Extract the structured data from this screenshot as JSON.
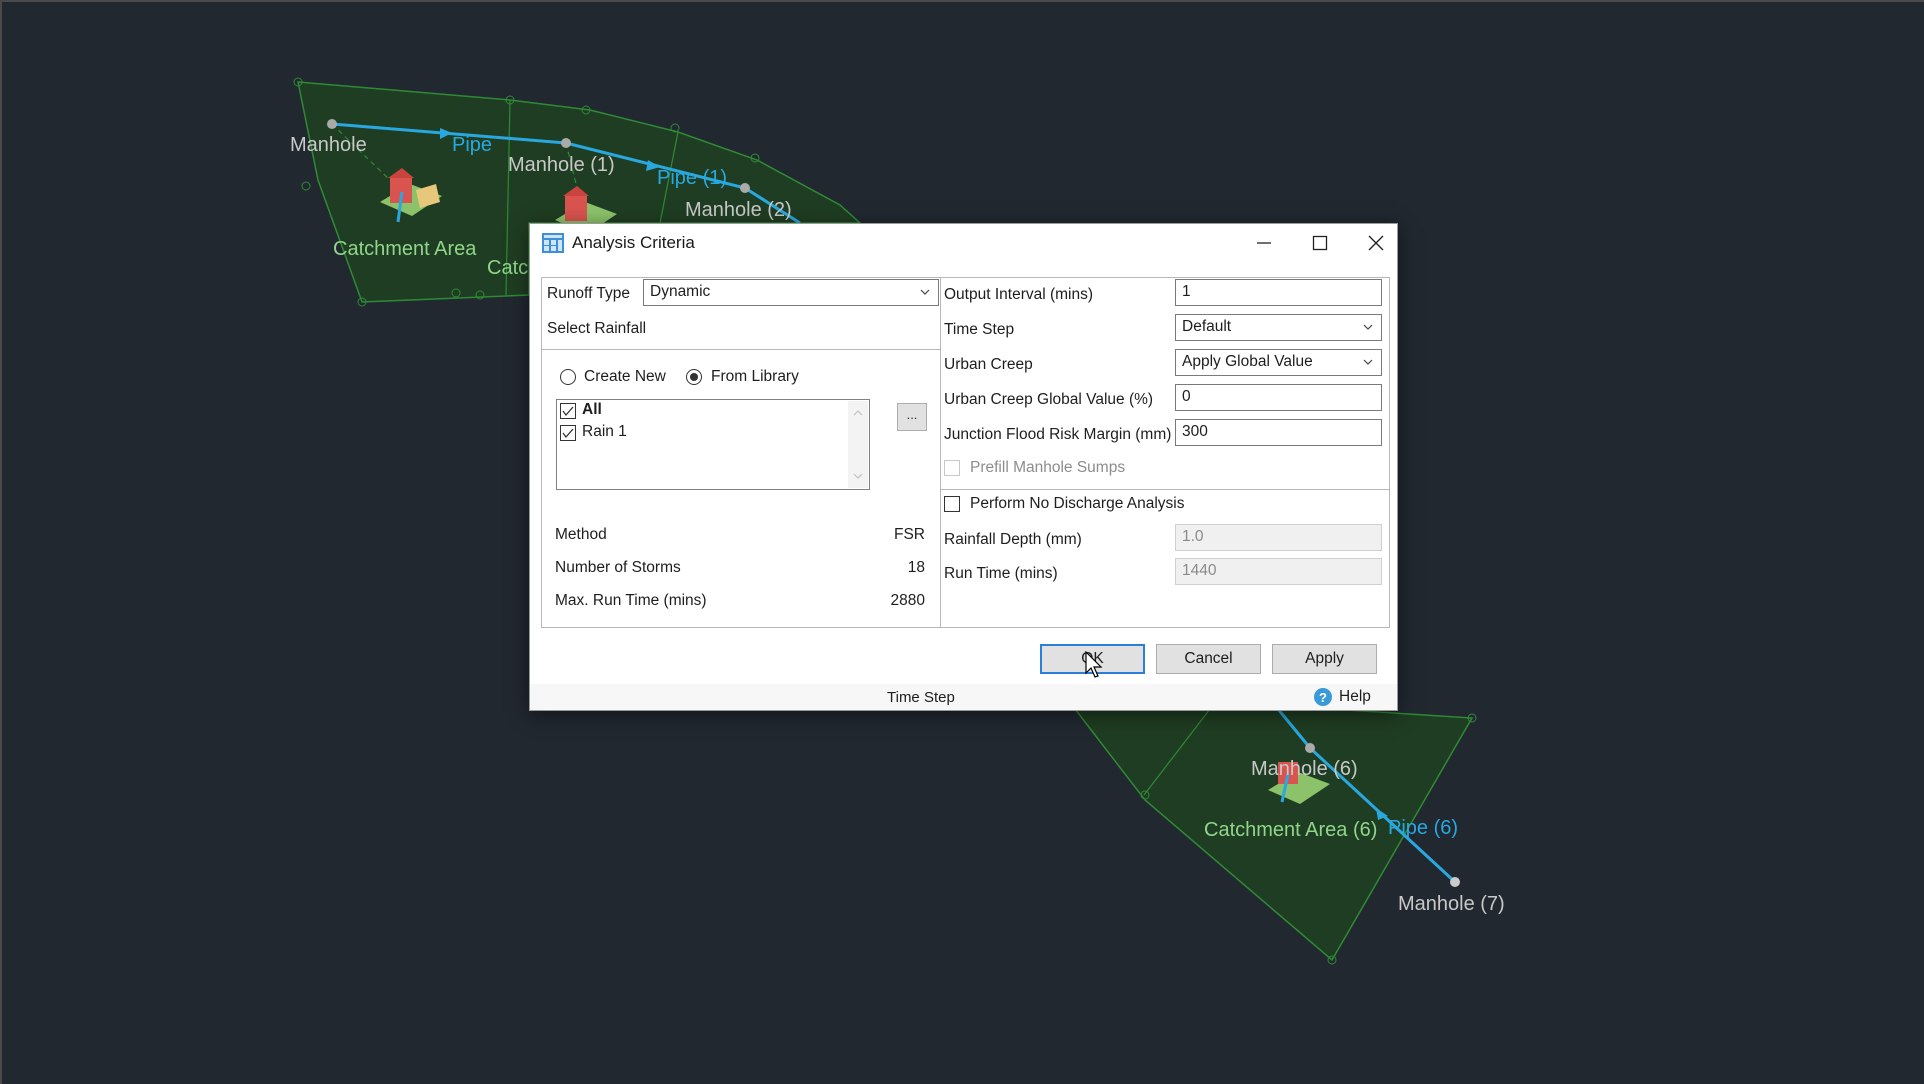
{
  "map": {
    "labels": {
      "manhole": "Manhole",
      "pipe": "Pipe",
      "manhole_1": "Manhole (1)",
      "pipe_1": "Pipe (1)",
      "manhole_2": "Manhole (2)",
      "catchment_area": "Catchment Area",
      "catchment_partial": "Catc",
      "manhole_6": "Manhole (6)",
      "catchment_area_6": "Catchment Area (6)",
      "pipe_6": "Pipe (6)",
      "manhole_7": "Manhole (7)"
    },
    "colors": {
      "background": "#212830",
      "catchment_fill": "#1f3d22",
      "catchment_edge": "#2f8a35",
      "pipe": "#29a8e0",
      "manhole_label": "#c8c8c8",
      "catchment_label": "#8fd68a"
    }
  },
  "dialog": {
    "title": "Analysis Criteria",
    "window_controls": {
      "minimize": "minimize",
      "maximize": "maximize",
      "close": "close"
    },
    "left": {
      "runoff_type_label": "Runoff Type",
      "runoff_type_value": "Dynamic",
      "select_rainfall_label": "Select Rainfall",
      "source_options": [
        {
          "label": "Create New",
          "selected": false
        },
        {
          "label": "From Library",
          "selected": true
        }
      ],
      "rainfall_list": [
        {
          "label": "All",
          "checked": true,
          "bold": true
        },
        {
          "label": "Rain 1",
          "checked": true,
          "bold": false
        }
      ],
      "browse_button": "...",
      "summary": [
        {
          "label": "Method",
          "value": "FSR"
        },
        {
          "label": "Number of Storms",
          "value": "18"
        },
        {
          "label": "Max. Run Time (mins)",
          "value": "2880"
        }
      ]
    },
    "right": {
      "output_interval_label": "Output Interval (mins)",
      "output_interval_value": "1",
      "time_step_label": "Time Step",
      "time_step_value": "Default",
      "urban_creep_label": "Urban Creep",
      "urban_creep_value": "Apply Global Value",
      "urban_creep_global_label": "Urban Creep Global Value (%)",
      "urban_creep_global_value": "0",
      "junction_flood_label": "Junction Flood Risk Margin (mm)",
      "junction_flood_value": "300",
      "prefill_label": "Prefill Manhole Sumps",
      "prefill_checked": false,
      "no_discharge_label": "Perform No Discharge Analysis",
      "no_discharge_checked": false,
      "rainfall_depth_label": "Rainfall Depth (mm)",
      "rainfall_depth_value": "1.0",
      "run_time_label": "Run Time (mins)",
      "run_time_value": "1440"
    },
    "buttons": {
      "ok": "OK",
      "cancel": "Cancel",
      "apply": "Apply"
    },
    "status": {
      "text": "Time Step",
      "help": "Help"
    },
    "colors": {
      "default_button_border": "#2b7fd7",
      "help_icon": "#3a9ad9"
    }
  }
}
